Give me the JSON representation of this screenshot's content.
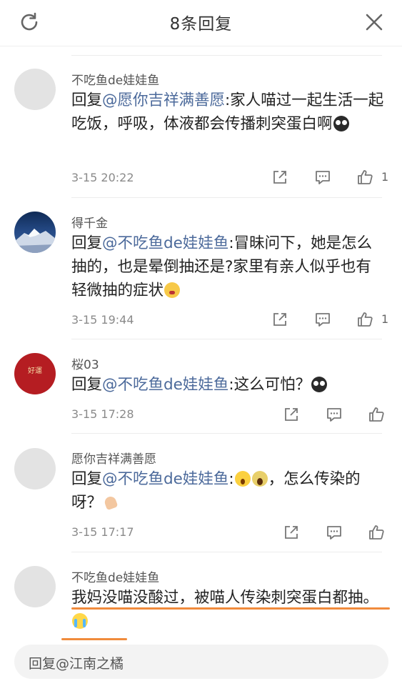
{
  "header": {
    "title": "8条回复",
    "refresh_icon": "refresh-icon",
    "close_icon": "close-icon"
  },
  "comments": [
    {
      "name": "不吃鱼de娃娃鱼",
      "avatar": "blank-avatar",
      "prefix": "回复",
      "mention": "@愿你吉祥满善愿",
      "body": ":家人喵过一起生活一起吃饭，呼吸，体液都会传播刺突蛋白啊",
      "emojis": [
        "scared-face-emoji"
      ],
      "time": "3-15 20:22",
      "likes": "1"
    },
    {
      "name": "得千金",
      "avatar": "mountain-avatar",
      "prefix": "回复",
      "mention": "@不吃鱼de娃娃鱼",
      "body": ":冒昧问下，她是怎么抽的，也是晕倒抽还是?家里有亲人似乎也有轻微抽的症状",
      "emojis": [
        "worried-face-emoji"
      ],
      "time": "3-15 19:44",
      "likes": "1"
    },
    {
      "name": "桜03",
      "avatar": "red-good-luck-avatar",
      "prefix": "回复",
      "mention": "@不吃鱼de娃娃鱼",
      "body": ":这么可怕？",
      "emojis": [
        "scared-face-emoji"
      ],
      "time": "3-15 17:28",
      "likes": ""
    },
    {
      "name": "愿你吉祥满善愿",
      "avatar": "blank-avatar",
      "prefix": "回复",
      "mention": "@不吃鱼de娃娃鱼",
      "body": ":",
      "body2": "，怎么传染的呀？",
      "emojis": [
        "shocked-face-emoji",
        "screaming-face-emoji",
        "praying-hands-emoji"
      ],
      "time": "3-15 17:17",
      "likes": ""
    },
    {
      "name": "不吃鱼de娃娃鱼",
      "avatar": "blank-avatar",
      "body": "我妈没喵没酸过，被喵人传染刺突蛋白都抽。",
      "emojis": [
        "crying-face-emoji"
      ]
    }
  ],
  "avatar_text": {
    "red": "好運"
  },
  "reply_bar": {
    "placeholder": "回复@江南之橘"
  },
  "colors": {
    "mention": "#4c6a9b",
    "underline": "#f08b3c",
    "header_text": "#333333"
  }
}
